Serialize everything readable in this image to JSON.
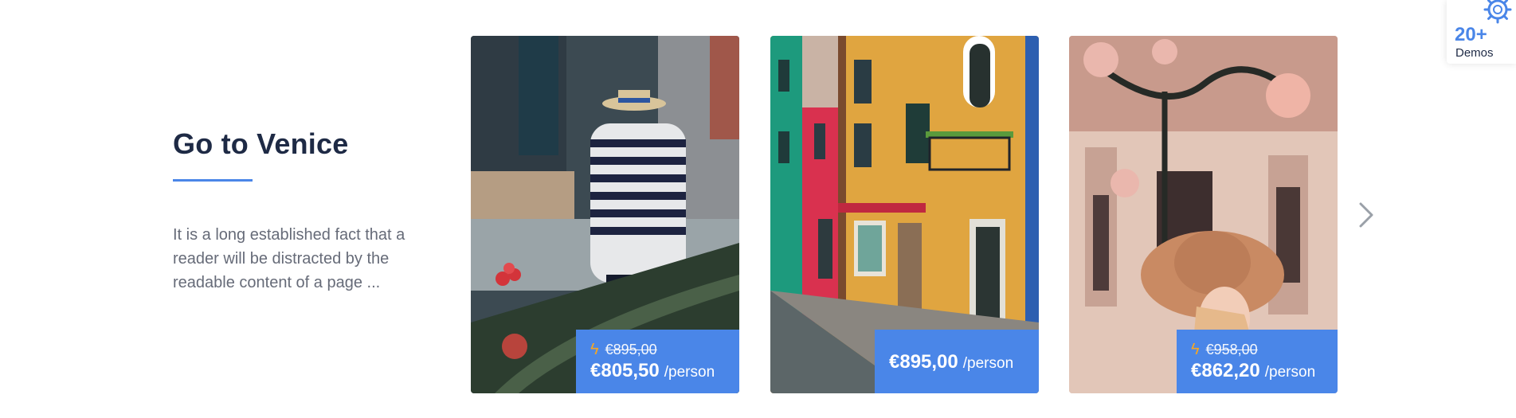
{
  "section": {
    "title": "Go to Venice",
    "description": "It is a long established fact that a reader will be distracted by the readable content of a page ..."
  },
  "cards": [
    {
      "old_price": "€895,00",
      "price": "€805,50",
      "per": "/person"
    },
    {
      "price": "€895,00",
      "per": "/person"
    },
    {
      "old_price": "€958,00",
      "price": "€862,20",
      "per": "/person"
    }
  ],
  "demos": {
    "count": "20+",
    "label": "Demos"
  },
  "icons": {
    "bolt": "lightning-icon",
    "next": "chevron-right-icon",
    "settings": "gear-icon"
  },
  "colors": {
    "accent": "#4a86e8",
    "heading": "#1e2a45",
    "bolt": "#f5a623",
    "text": "#666b78"
  }
}
